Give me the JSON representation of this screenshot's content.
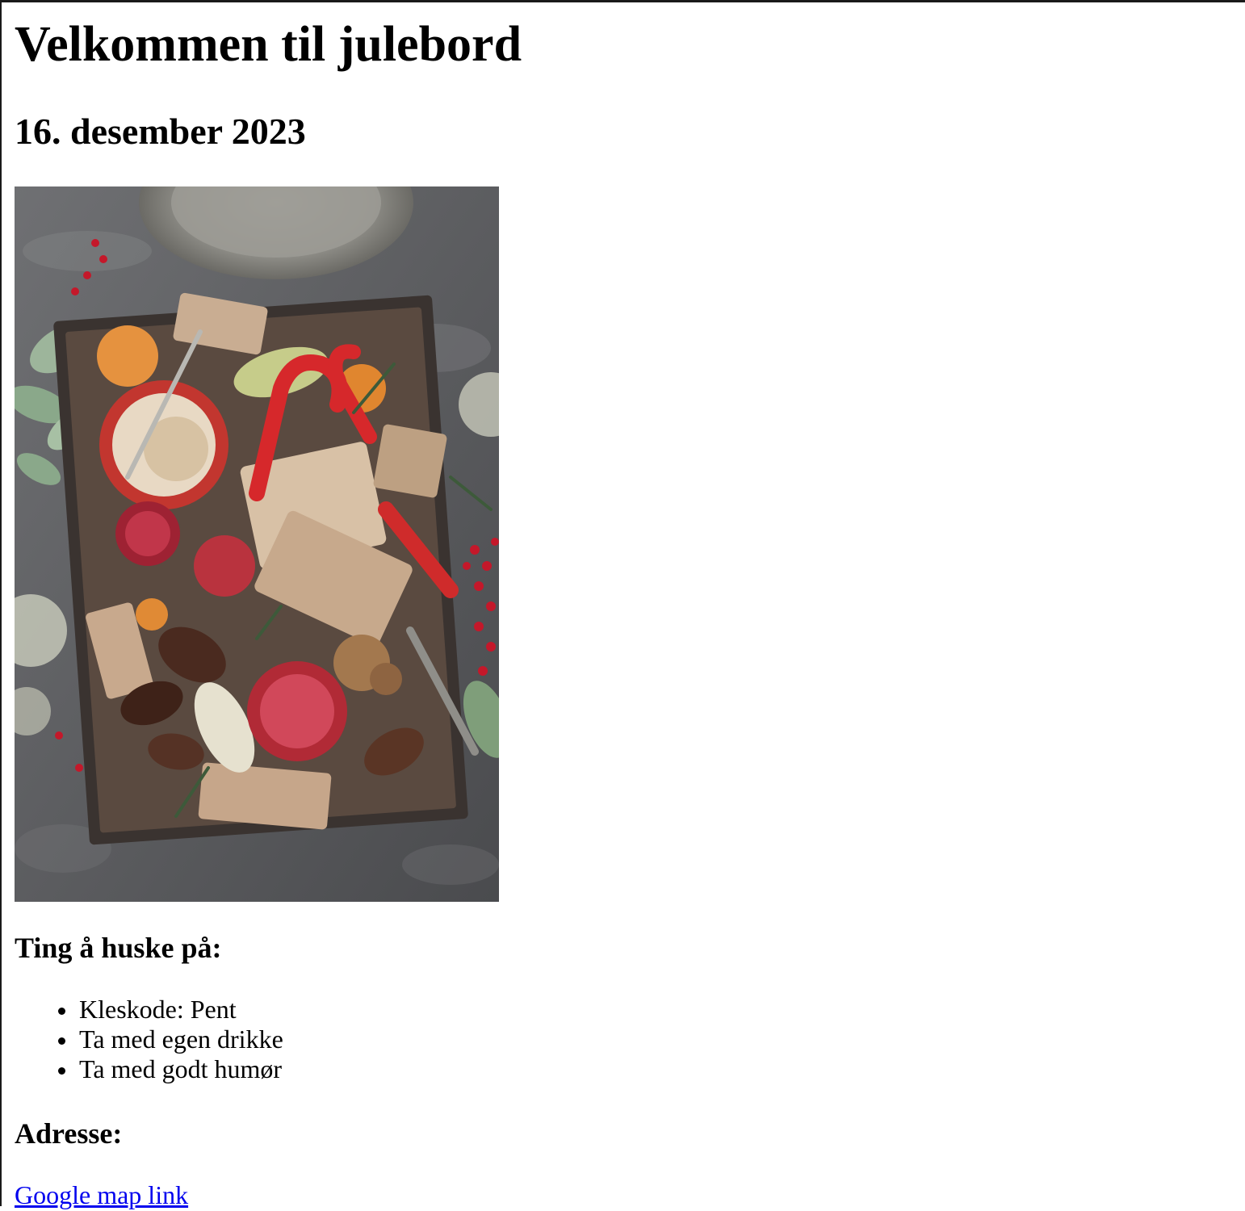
{
  "page": {
    "title": "Velkommen til julebord",
    "date": "16. desember 2023"
  },
  "image": {
    "subject": "christmas-food-platter-photo"
  },
  "reminders": {
    "heading": "Ting å huske på:",
    "items": [
      "Kleskode: Pent",
      "Ta med egen drikke",
      "Ta med godt humør"
    ]
  },
  "address": {
    "heading": "Adresse:",
    "link_label": "Google map link"
  },
  "colors": {
    "link": "#0000ee",
    "text": "#000000",
    "background": "#ffffff"
  }
}
